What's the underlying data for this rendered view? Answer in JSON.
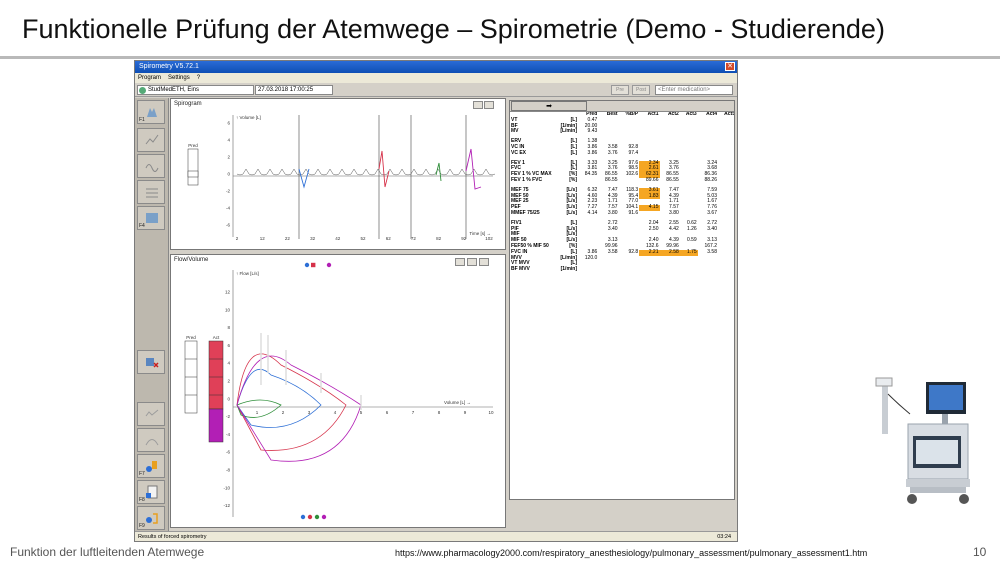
{
  "slide": {
    "title": "Funktionelle Prüfung der Atemwege – Spirometrie (Demo - Studierende)",
    "footer_left": "Funktion der luftleitenden Atemwege",
    "footer_url": "https://www.pharmacology2000.com/respiratory_anesthesiology/pulmonary_assessment/pulmonary_assessment1.htm",
    "page_number": "10"
  },
  "app": {
    "window_title": "Spirometry V5.72.1",
    "menu": [
      "Program",
      "Settings",
      "?"
    ],
    "patient": "StudMedETH, Eins",
    "datetime": "27.03.2018 17:00:25",
    "medication_placeholder": "<Enter medication>",
    "pre_label": "Pre",
    "post_label": "Post",
    "status_text": "Results of forced spirometry",
    "status_time": "03:24",
    "arrow_button": "➡"
  },
  "spirogram": {
    "label": "Spirogram",
    "y_axis_label": "Volume [L]",
    "x_axis_label": "Time [s]",
    "pred_label": "Pred",
    "y_ticks": [
      "6",
      "4",
      "2",
      "0",
      "-2",
      "-4",
      "-6"
    ],
    "x_ticks": [
      "2",
      "12",
      "22",
      "32",
      "42",
      "52",
      "62",
      "72",
      "82",
      "92",
      "102"
    ]
  },
  "flow_volume": {
    "label": "Flow/Volume",
    "y_axis_label": "Flow [L/s]",
    "x_axis_label": "Volume [L]",
    "pred_label": "Pred",
    "act_label": "Act",
    "y_ticks": [
      "12",
      "10",
      "8",
      "6",
      "4",
      "2",
      "0",
      "-2",
      "-4",
      "-6",
      "-8",
      "-10",
      "-12"
    ],
    "x_ticks": [
      "1",
      "2",
      "3",
      "4",
      "5",
      "6",
      "7",
      "8",
      "9",
      "10"
    ]
  },
  "table": {
    "headers": [
      "",
      "",
      "Pred",
      "Best",
      "%B/P",
      "Act1",
      "Act2",
      "Act3",
      "Act4",
      "Act5"
    ],
    "rows": [
      [
        "VT",
        "[L]",
        "0.47",
        "",
        "",
        "",
        "",
        "",
        "",
        ""
      ],
      [
        "BF",
        "[1/min]",
        "20.00",
        "",
        "",
        "",
        "",
        "",
        "",
        ""
      ],
      [
        "MV",
        "[L/min]",
        "9.43",
        "",
        "",
        "",
        "",
        "",
        "",
        ""
      ],
      [
        "",
        "",
        "",
        "",
        "",
        "",
        "",
        "",
        "",
        ""
      ],
      [
        "ERV",
        "[L]",
        "1.38",
        "",
        "",
        "",
        "",
        "",
        "",
        ""
      ],
      [
        "VC IN",
        "[L]",
        "3.86",
        "3.58",
        "92.8",
        "",
        "",
        "",
        "",
        ""
      ],
      [
        "VC EX",
        "[L]",
        "3.86",
        "3.76",
        "97.4",
        "",
        "",
        "",
        "",
        ""
      ],
      [
        "",
        "",
        "",
        "",
        "",
        "",
        "",
        "",
        "",
        ""
      ],
      [
        "FEV 1",
        "[L]",
        "3.33",
        "3.25",
        "97.6",
        "2.34",
        "3.25",
        "",
        "3.24",
        ""
      ],
      [
        "FVC",
        "[L]",
        "3.81",
        "3.76",
        "98.5",
        "2.61",
        "3.76",
        "",
        "3.68",
        ""
      ],
      [
        "FEV 1 % VC MAX",
        "[%]",
        "84.35",
        "86.55",
        "102.6",
        "62.31",
        "86.55",
        "",
        "86.36",
        ""
      ],
      [
        "FEV 1 % FVC",
        "[%]",
        "",
        "86.55",
        "",
        "89.66",
        "86.55",
        "",
        "88.26",
        ""
      ],
      [
        "",
        "",
        "",
        "",
        "",
        "",
        "",
        "",
        "",
        ""
      ],
      [
        "MEF 75",
        "[L/s]",
        "6.32",
        "7.47",
        "118.3",
        "3.61",
        "7.47",
        "",
        "7.59",
        ""
      ],
      [
        "MEF 50",
        "[L/s]",
        "4.60",
        "4.39",
        "95.4",
        "1.83",
        "4.39",
        "",
        "5.03",
        ""
      ],
      [
        "MEF 25",
        "[L/s]",
        "2.23",
        "1.71",
        "77.0",
        "",
        "1.71",
        "",
        "1.67",
        ""
      ],
      [
        "PEF",
        "[L/s]",
        "7.27",
        "7.57",
        "104.1",
        "4.15",
        "7.57",
        "",
        "7.76",
        ""
      ],
      [
        "MMEF 75/25",
        "[L/s]",
        "4.14",
        "3.80",
        "91.6",
        "",
        "3.80",
        "",
        "3.67",
        ""
      ],
      [
        "",
        "",
        "",
        "",
        "",
        "",
        "",
        "",
        "",
        ""
      ],
      [
        "FIV1",
        "[L]",
        "",
        "2.72",
        "",
        "2.04",
        "2.55",
        "0.62",
        "2.72",
        ""
      ],
      [
        "PIF",
        "[L/s]",
        "",
        "3.40",
        "",
        "2.50",
        "4.42",
        "1.26",
        "3.40",
        ""
      ],
      [
        "MIF",
        "[L/s]",
        "",
        "",
        "",
        "",
        "",
        "",
        "",
        ""
      ],
      [
        "MIF 50",
        "[L/s]",
        "",
        "3.13",
        "",
        "2.40",
        "4.39",
        "0.59",
        "3.13",
        ""
      ],
      [
        "FEF50 % MIF 50",
        "[%]",
        "",
        "99.96",
        "",
        "132.6",
        "99.96",
        "",
        "167.2",
        ""
      ],
      [
        "FVC IN",
        "[L]",
        "3.86",
        "3.58",
        "92.8",
        "2.21",
        "2.58",
        "1.75",
        "3.58",
        ""
      ],
      [
        "MVV",
        "[L/min]",
        "120.0",
        "",
        "",
        "",
        "",
        "",
        "",
        ""
      ],
      [
        "VT MVV",
        "[L]",
        "",
        "",
        "",
        "",
        "",
        "",
        "",
        ""
      ],
      [
        "BF MVV",
        "[1/min]",
        "",
        "",
        "",
        "",
        "",
        "",
        "",
        ""
      ]
    ],
    "highlight_color": "#f5a623"
  },
  "curve_colors": {
    "trial1": "#2d6fd6",
    "trial2": "#d6324a",
    "trial3": "#2f8f3a",
    "trial4": "#b21fb5"
  }
}
